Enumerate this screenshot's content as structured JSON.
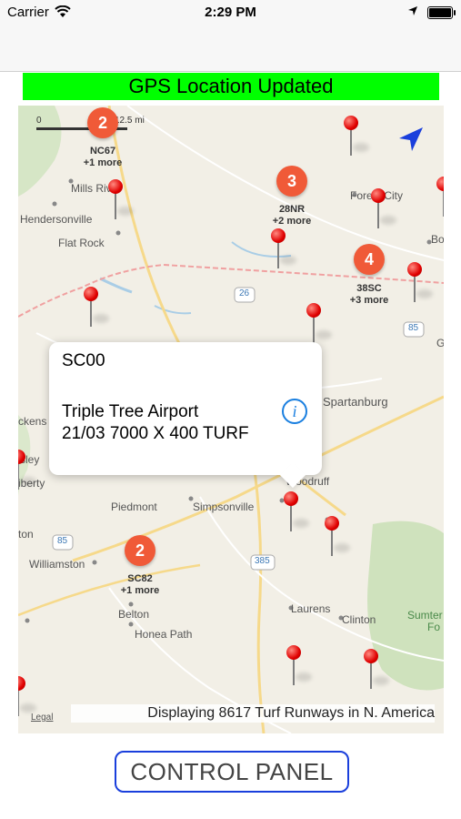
{
  "status_bar": {
    "carrier": "Carrier",
    "time": "2:29 PM"
  },
  "banner": {
    "text": "GPS Location Updated",
    "color": "#00ff00"
  },
  "map": {
    "scale": {
      "zero": "0",
      "max": "12.5 mi"
    },
    "towns": [
      "Mills River",
      "Hendersonville",
      "Flat Rock",
      "Forest City",
      "Bo",
      "Spartanburg",
      "Woodruff",
      "Piedmont",
      "Simpsonville",
      "Williamston",
      "Belton",
      "Honea Path",
      "Laurens",
      "Clinton",
      "Sumter",
      "Fo",
      "ckens",
      "sley",
      "iberty",
      "ton",
      "G"
    ],
    "clusters": [
      {
        "count": "2",
        "code": "NC67",
        "more": "+1 more"
      },
      {
        "count": "3",
        "code": "28NR",
        "more": "+2 more"
      },
      {
        "count": "4",
        "code": "38SC",
        "more": "+3 more"
      },
      {
        "count": "2",
        "code": "SC82",
        "more": "+1 more"
      }
    ],
    "callout": {
      "code": "SC00",
      "name": "Triple Tree Airport",
      "runway": "21/03 7000 X 400 TURF",
      "info_icon": "info-icon"
    },
    "highway_shields": [
      "26",
      "85",
      "385",
      "85"
    ],
    "legal": "Legal",
    "display_count": "Displaying 8617 Turf Runways in N. America"
  },
  "control_panel": {
    "label": "CONTROL PANEL",
    "border_color": "#1a3fdc"
  },
  "colors": {
    "pin": "#e00000",
    "cluster": "#f05a38",
    "map_bg": "#f2efe6"
  }
}
